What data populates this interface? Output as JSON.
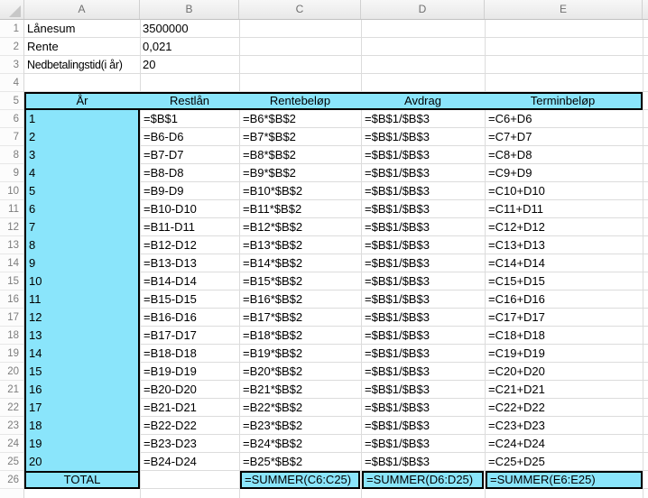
{
  "app": {
    "kind": "spreadsheet-formula-view"
  },
  "colors": {
    "highlight": "#8AE5FB",
    "thick_border": "#000000",
    "gridline": "#DCDCDC"
  },
  "columns": [
    "A",
    "B",
    "C",
    "D",
    "E"
  ],
  "row_numbers": [
    "1",
    "2",
    "3",
    "4",
    "5",
    "6",
    "7",
    "8",
    "9",
    "10",
    "11",
    "12",
    "13",
    "14",
    "15",
    "16",
    "17",
    "18",
    "19",
    "20",
    "21",
    "22",
    "23",
    "24",
    "25",
    "26"
  ],
  "info_cells": [
    {
      "label": "Lånesum",
      "value": "3500000"
    },
    {
      "label": "Rente",
      "value": "0,021"
    },
    {
      "label": "Nedbetalingstid(i år)",
      "value": "20"
    }
  ],
  "table": {
    "headers": [
      "År",
      "Restlån",
      "Rentebeløp",
      "Avdrag",
      "Terminbeløp"
    ],
    "rows": [
      {
        "year": "1",
        "restlan": "=$B$1",
        "rentebelop": "=B6*$B$2",
        "avdrag": "=$B$1/$B$3",
        "terminbelop": "=C6+D6"
      },
      {
        "year": "2",
        "restlan": "=B6-D6",
        "rentebelop": "=B7*$B$2",
        "avdrag": "=$B$1/$B$3",
        "terminbelop": "=C7+D7"
      },
      {
        "year": "3",
        "restlan": "=B7-D7",
        "rentebelop": "=B8*$B$2",
        "avdrag": "=$B$1/$B$3",
        "terminbelop": "=C8+D8"
      },
      {
        "year": "4",
        "restlan": "=B8-D8",
        "rentebelop": "=B9*$B$2",
        "avdrag": "=$B$1/$B$3",
        "terminbelop": "=C9+D9"
      },
      {
        "year": "5",
        "restlan": "=B9-D9",
        "rentebelop": "=B10*$B$2",
        "avdrag": "=$B$1/$B$3",
        "terminbelop": "=C10+D10"
      },
      {
        "year": "6",
        "restlan": "=B10-D10",
        "rentebelop": "=B11*$B$2",
        "avdrag": "=$B$1/$B$3",
        "terminbelop": "=C11+D11"
      },
      {
        "year": "7",
        "restlan": "=B11-D11",
        "rentebelop": "=B12*$B$2",
        "avdrag": "=$B$1/$B$3",
        "terminbelop": "=C12+D12"
      },
      {
        "year": "8",
        "restlan": "=B12-D12",
        "rentebelop": "=B13*$B$2",
        "avdrag": "=$B$1/$B$3",
        "terminbelop": "=C13+D13"
      },
      {
        "year": "9",
        "restlan": "=B13-D13",
        "rentebelop": "=B14*$B$2",
        "avdrag": "=$B$1/$B$3",
        "terminbelop": "=C14+D14"
      },
      {
        "year": "10",
        "restlan": "=B14-D14",
        "rentebelop": "=B15*$B$2",
        "avdrag": "=$B$1/$B$3",
        "terminbelop": "=C15+D15"
      },
      {
        "year": "11",
        "restlan": "=B15-D15",
        "rentebelop": "=B16*$B$2",
        "avdrag": "=$B$1/$B$3",
        "terminbelop": "=C16+D16"
      },
      {
        "year": "12",
        "restlan": "=B16-D16",
        "rentebelop": "=B17*$B$2",
        "avdrag": "=$B$1/$B$3",
        "terminbelop": "=C17+D17"
      },
      {
        "year": "13",
        "restlan": "=B17-D17",
        "rentebelop": "=B18*$B$2",
        "avdrag": "=$B$1/$B$3",
        "terminbelop": "=C18+D18"
      },
      {
        "year": "14",
        "restlan": "=B18-D18",
        "rentebelop": "=B19*$B$2",
        "avdrag": "=$B$1/$B$3",
        "terminbelop": "=C19+D19"
      },
      {
        "year": "15",
        "restlan": "=B19-D19",
        "rentebelop": "=B20*$B$2",
        "avdrag": "=$B$1/$B$3",
        "terminbelop": "=C20+D20"
      },
      {
        "year": "16",
        "restlan": "=B20-D20",
        "rentebelop": "=B21*$B$2",
        "avdrag": "=$B$1/$B$3",
        "terminbelop": "=C21+D21"
      },
      {
        "year": "17",
        "restlan": "=B21-D21",
        "rentebelop": "=B22*$B$2",
        "avdrag": "=$B$1/$B$3",
        "terminbelop": "=C22+D22"
      },
      {
        "year": "18",
        "restlan": "=B22-D22",
        "rentebelop": "=B23*$B$2",
        "avdrag": "=$B$1/$B$3",
        "terminbelop": "=C23+D23"
      },
      {
        "year": "19",
        "restlan": "=B23-D23",
        "rentebelop": "=B24*$B$2",
        "avdrag": "=$B$1/$B$3",
        "terminbelop": "=C24+D24"
      },
      {
        "year": "20",
        "restlan": "=B24-D24",
        "rentebelop": "=B25*$B$2",
        "avdrag": "=$B$1/$B$3",
        "terminbelop": "=C25+D25"
      }
    ],
    "total_label": "TOTAL",
    "totals": {
      "rentebelop": "=SUMMER(C6:C25)",
      "avdrag": "=SUMMER(D6:D25)",
      "terminbelop": "=SUMMER(E6:E25)"
    }
  }
}
